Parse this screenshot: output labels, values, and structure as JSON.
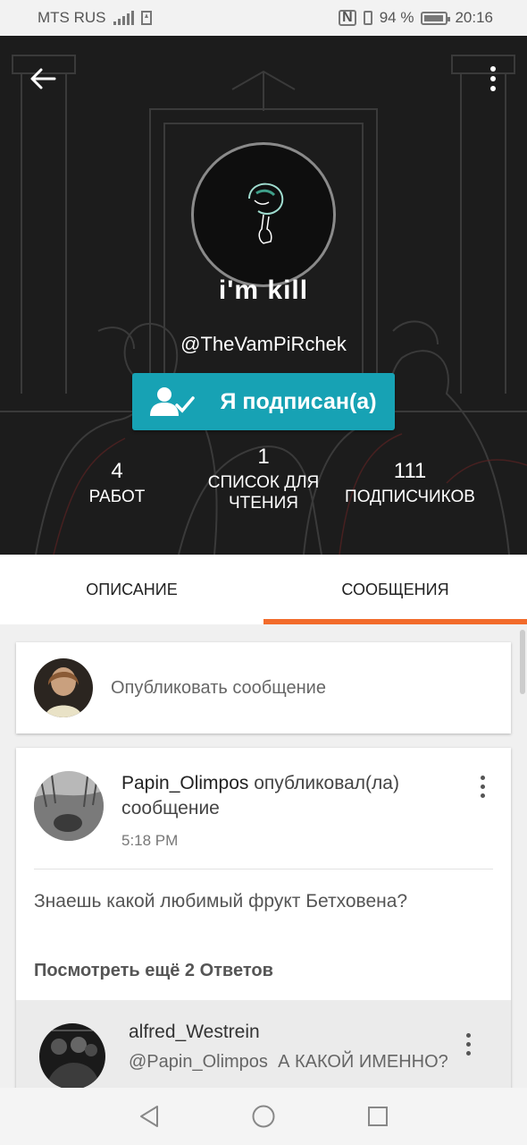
{
  "status_bar": {
    "carrier": "MTS RUS",
    "battery_percent": "94 %",
    "time": "20:16"
  },
  "profile": {
    "display_name": "i'm kill",
    "username": "@TheVamPiRchek",
    "follow_button_label": "Я подписан(а)",
    "stats": [
      {
        "value": "4",
        "label": "РАБОТ"
      },
      {
        "value": "1",
        "label": "СПИСОК ДЛЯ ЧТЕНИЯ"
      },
      {
        "value": "111",
        "label": "ПОДПИСЧИКОВ"
      }
    ]
  },
  "tabs": [
    {
      "label": "ОПИСАНИЕ",
      "active": false
    },
    {
      "label": "СООБЩЕНИЯ",
      "active": true
    }
  ],
  "accent_color": "#f26b2b",
  "follow_color": "#17a2b4",
  "compose": {
    "placeholder": "Опубликовать сообщение"
  },
  "post": {
    "author": "Papin_Olimpos",
    "action": "опубликовал(ла) сообщение",
    "time": "5:18 PM",
    "text": "Знаешь какой любимый фрукт Бетховена?",
    "view_more_replies": "Посмотреть ещё 2 Ответов",
    "reply": {
      "author": "alfred_Westrein",
      "mention": "@Papin_Olimpos",
      "text": "А КАКОЙ ИМЕННО?"
    }
  },
  "icons": {
    "back": "arrow-left-icon",
    "more": "more-vertical-icon",
    "follow": "user-check-icon",
    "nav": [
      "back-triangle-icon",
      "home-circle-icon",
      "recents-square-icon"
    ]
  }
}
